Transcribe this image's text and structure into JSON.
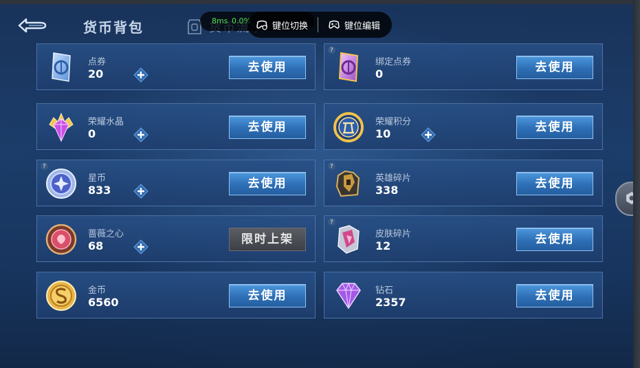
{
  "header": {
    "back_icon": "back-arrow-icon",
    "tab_bag": "货币背包",
    "tab_flow": "货币流水",
    "flow_icon": "currency-flow-icon"
  },
  "overlay": {
    "ping": "8ms",
    "loss": "0.0%",
    "key_switch": "键位切换",
    "key_edit": "键位编辑"
  },
  "currencies": [
    {
      "name": "点券",
      "amount": "20",
      "icon": "voucher-card-icon",
      "plus": true,
      "help": false,
      "action": "去使用"
    },
    {
      "name": "绑定点券",
      "amount": "0",
      "icon": "bound-voucher-card-icon",
      "plus": false,
      "help": true,
      "action": "去使用"
    },
    {
      "name": "荣耀水晶",
      "amount": "0",
      "icon": "glory-crystal-icon",
      "plus": true,
      "help": false,
      "action": "去使用"
    },
    {
      "name": "荣耀积分",
      "amount": "10",
      "icon": "glory-points-icon",
      "plus": true,
      "help": false,
      "action": "去使用"
    },
    {
      "name": "星币",
      "amount": "833",
      "icon": "star-coin-icon",
      "plus": true,
      "help": true,
      "action": "去使用"
    },
    {
      "name": "英雄碎片",
      "amount": "338",
      "icon": "hero-fragment-icon",
      "plus": false,
      "help": true,
      "action": "去使用"
    },
    {
      "name": "蔷薇之心",
      "amount": "68",
      "icon": "rose-heart-icon",
      "plus": true,
      "help": false,
      "action": "限时上架"
    },
    {
      "name": "皮肤碎片",
      "amount": "12",
      "icon": "skin-fragment-icon",
      "plus": false,
      "help": true,
      "action": "去使用"
    },
    {
      "name": "金币",
      "amount": "6560",
      "icon": "gold-coin-icon",
      "plus": false,
      "help": false,
      "action": "去使用"
    },
    {
      "name": "钻石",
      "amount": "2357",
      "icon": "diamond-icon",
      "plus": false,
      "help": false,
      "action": "去使用"
    }
  ],
  "colors": {
    "use_button": "#2e6fb6",
    "limited_button": "#4a4d53",
    "ping_text": "#4fe24f"
  }
}
